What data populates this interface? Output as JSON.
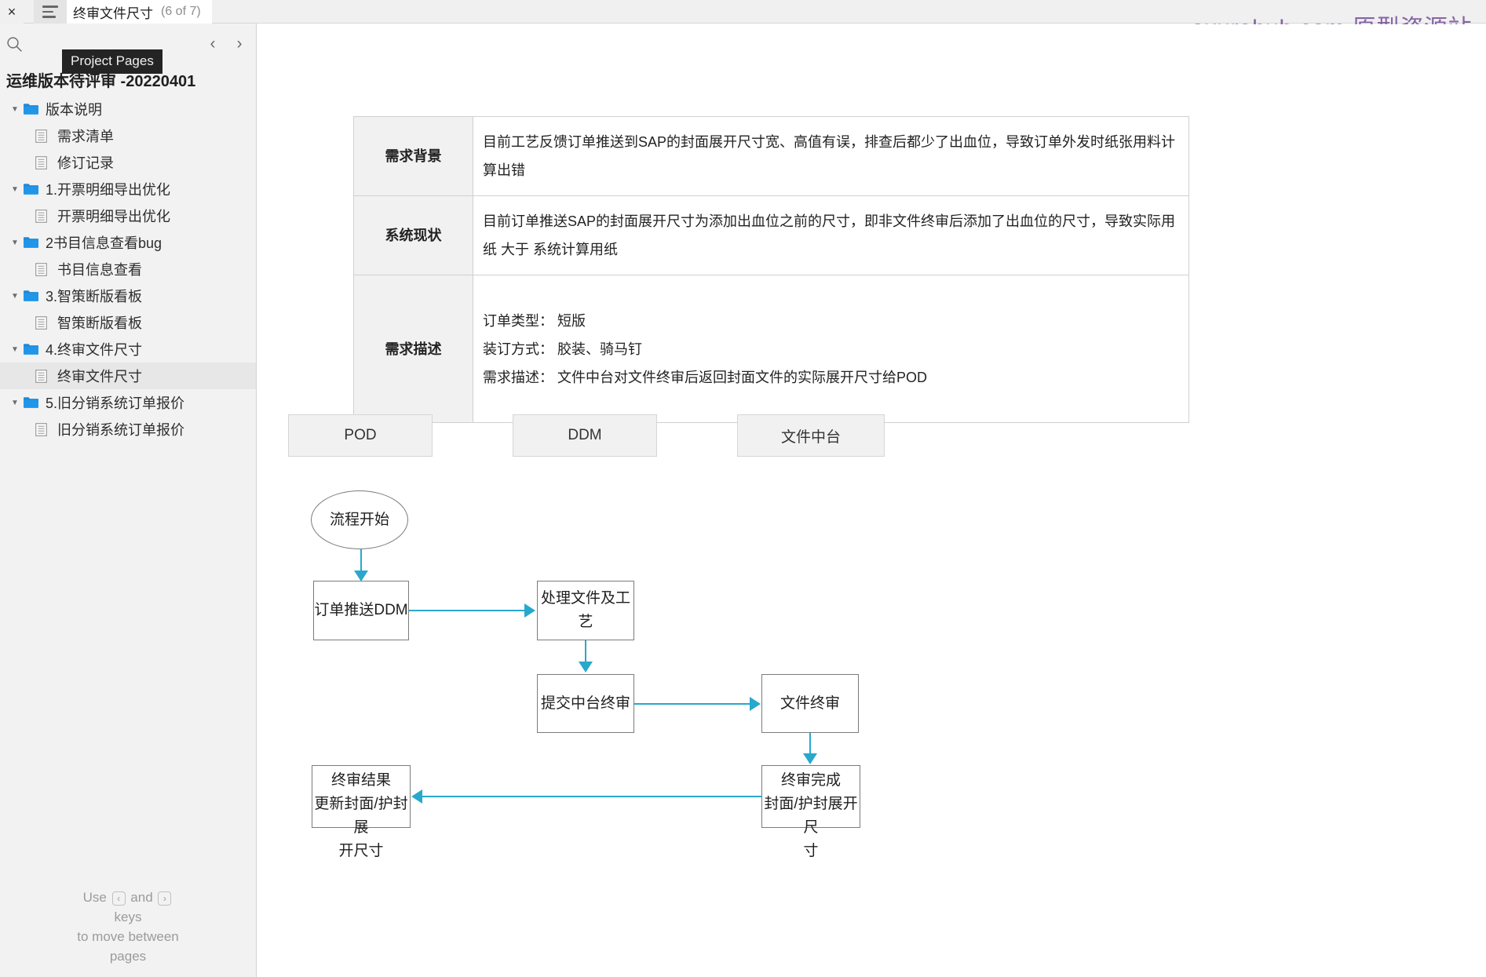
{
  "topbar": {
    "close_label": "×",
    "menu_icon": "hamburger-icon",
    "page_title": "终审文件尺寸",
    "page_counter": "(6 of 7)",
    "watermark": "axurehub.com 原型资源站",
    "watermark_color": "#7c5aa0"
  },
  "sidebar": {
    "tooltip": "Project Pages",
    "search_icon": "search-icon",
    "prev_label": "‹",
    "next_label": "›",
    "project_name": "运维版本待评审 -20220401",
    "tree": [
      {
        "type": "folder",
        "label": "版本说明",
        "expanded": true,
        "selected": false
      },
      {
        "type": "page",
        "label": "需求清单",
        "selected": false
      },
      {
        "type": "page",
        "label": "修订记录",
        "selected": false
      },
      {
        "type": "folder",
        "label": "1.开票明细导出优化",
        "expanded": true,
        "selected": false
      },
      {
        "type": "page",
        "label": "开票明细导出优化",
        "selected": false
      },
      {
        "type": "folder",
        "label": "2书目信息查看bug",
        "expanded": true,
        "selected": false
      },
      {
        "type": "page",
        "label": "书目信息查看",
        "selected": false
      },
      {
        "type": "folder",
        "label": "3.智策断版看板",
        "expanded": true,
        "selected": false
      },
      {
        "type": "page",
        "label": "智策断版看板",
        "selected": false
      },
      {
        "type": "folder",
        "label": "4.终审文件尺寸",
        "expanded": true,
        "selected": false
      },
      {
        "type": "page",
        "label": "终审文件尺寸",
        "selected": true
      },
      {
        "type": "folder",
        "label": "5.旧分销系统订单报价",
        "expanded": true,
        "selected": false
      },
      {
        "type": "page",
        "label": "旧分销系统订单报价",
        "selected": false
      }
    ],
    "help": {
      "line1_pre": "Use",
      "key_prev": "‹",
      "line1_mid": "and",
      "key_next": "›",
      "line2": "keys",
      "line3": "to move between",
      "line4": "pages"
    }
  },
  "main": {
    "table": {
      "rows": [
        {
          "header": "需求背景",
          "body": "目前工艺反馈订单推送到SAP的封面展开尺寸宽、高值有误，排查后都少了出血位，导致订单外发时纸张用料计算出错"
        },
        {
          "header": "系统现状",
          "body": "目前订单推送SAP的封面展开尺寸为添加出血位之前的尺寸，即非文件终审后添加了出血位的尺寸，导致实际用纸 大于 系统计算用纸"
        },
        {
          "header": "需求描述",
          "lines": [
            "订单类型： 短版",
            "装订方式： 胶装、骑马钉",
            "需求描述： 文件中台对文件终审后返回封面文件的实际展开尺寸给POD"
          ]
        }
      ]
    },
    "flowchart": {
      "accent_color": "#28a8cd",
      "lanes": [
        {
          "label": "POD"
        },
        {
          "label": "DDM"
        },
        {
          "label": "文件中台"
        }
      ],
      "nodes": [
        {
          "id": "start",
          "label": "流程开始"
        },
        {
          "id": "push",
          "label": "订单推送DDM"
        },
        {
          "id": "process",
          "label": "处理文件及工艺"
        },
        {
          "id": "submit",
          "label": "提交中台终审"
        },
        {
          "id": "final",
          "label": "文件终审"
        },
        {
          "id": "result",
          "line1": "终审结果",
          "line2": "更新封面/护封展",
          "line3": "开尺寸"
        },
        {
          "id": "complete",
          "line1": "终审完成",
          "line2": "封面/护封展开尺",
          "line3": "寸"
        }
      ]
    }
  }
}
